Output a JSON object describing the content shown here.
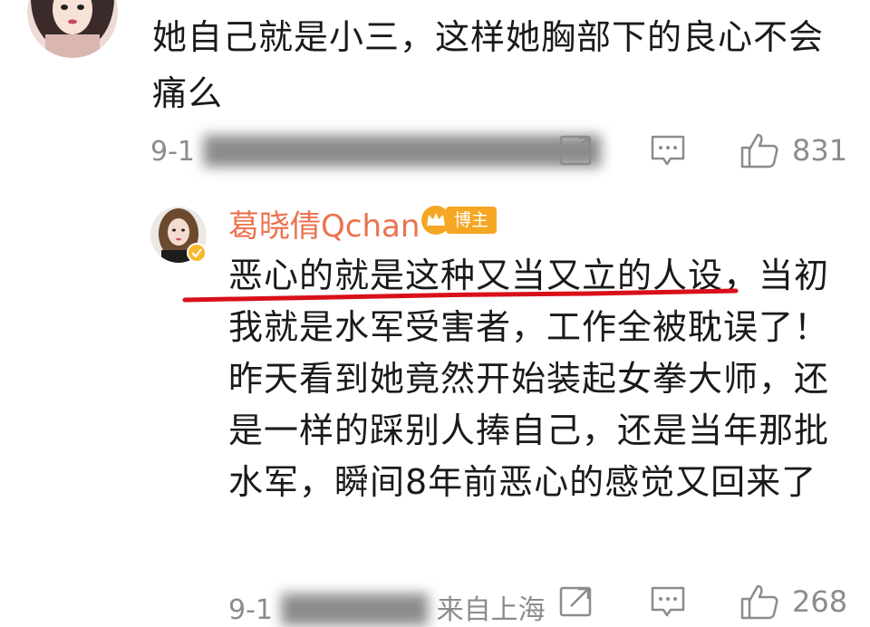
{
  "comment1": {
    "text": "她自己就是小三，这样她胸部下的良心不会痛么",
    "meta": "9-1",
    "likes": "831"
  },
  "reply": {
    "author": "葛晓倩Qchan",
    "badge": "博主",
    "text": "恶心的就是这种又当又立的人设，当初我就是水军受害者，工作全被耽误了！昨天看到她竟然开始装起女拳大师，还是一样的踩别人捧自己，还是当年那批水军，瞬间8年前恶心的感觉又回来了",
    "meta_date": "9-1",
    "meta_location": "来自上海",
    "likes": "268"
  },
  "colors": {
    "author_name": "#eb7350",
    "badge": "#f5a623",
    "underline": "#d8101a",
    "meta": "#8c8c8c"
  },
  "icons": [
    "share-icon",
    "comment-icon",
    "like-icon",
    "verified-icon",
    "crown-icon"
  ]
}
